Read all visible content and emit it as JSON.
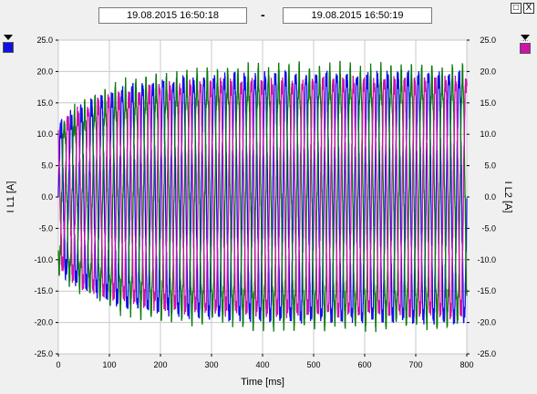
{
  "header": {
    "start_time": "19.08.2015     16:50:18",
    "separator": "-",
    "end_time": "19.08.2015     16:50:19"
  },
  "window": {
    "maximize_glyph": "□",
    "close_glyph": "X"
  },
  "colors": {
    "series1": "#1010e6",
    "series2": "#d011a8",
    "series3": "#0a7a0a",
    "grid": "#c8c8c8",
    "plot_bg": "#ffffff"
  },
  "chart_data": {
    "type": "line",
    "xlabel": "Time [ms]",
    "ylabel_left": "I L1 [A]",
    "ylabel_right": "I L2 [A]",
    "xlim": [
      0,
      800
    ],
    "ylim": [
      -25,
      25
    ],
    "x_ticks": [
      "0",
      "100",
      "200",
      "300",
      "400",
      "500",
      "600",
      "700",
      "800"
    ],
    "y_ticks": [
      "25.0",
      "20.0",
      "15.0",
      "10.0",
      "5.0",
      "0.0",
      "-5.0",
      "-10.0",
      "-15.0",
      "-20.0",
      "-25.0"
    ],
    "grid": true,
    "signal": {
      "frequency_hz": 50,
      "cycles": 40,
      "duration_ms": 800
    },
    "series": [
      {
        "color": "#1010e6",
        "phase_deg": 0,
        "amplitude_start": 11,
        "amplitude_end": 19.5
      },
      {
        "color": "#0a7a0a",
        "phase_deg": 120,
        "amplitude_start": 11,
        "amplitude_end": 19.5
      },
      {
        "color": "#d011a8",
        "phase_deg": 240,
        "amplitude_start": 11,
        "amplitude_end": 18.5
      }
    ]
  }
}
